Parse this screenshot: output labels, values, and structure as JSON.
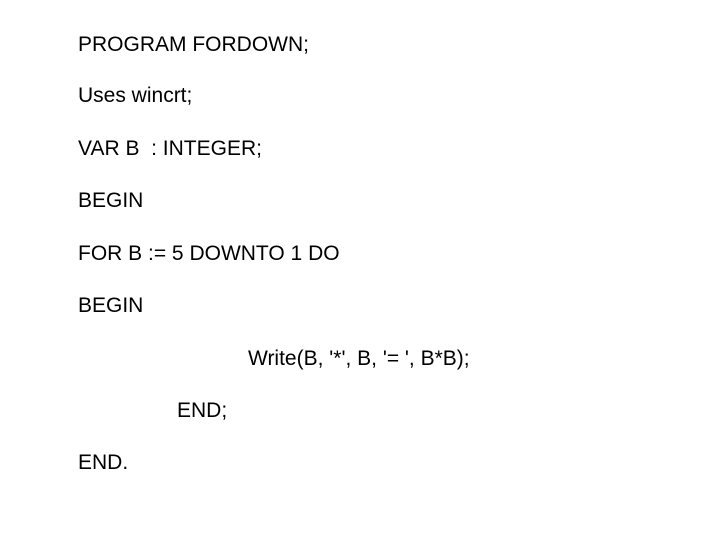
{
  "code": {
    "line1": "PROGRAM FORDOWN;",
    "line2": "Uses wincrt;",
    "line3": "VAR B  : INTEGER;",
    "line4": "BEGIN",
    "line5": "FOR B := 5 DOWNTO 1 DO",
    "line6": "BEGIN",
    "line7": "Write(B, '*', B, '= ', B*B);",
    "line8": "END;",
    "line9": "END."
  }
}
